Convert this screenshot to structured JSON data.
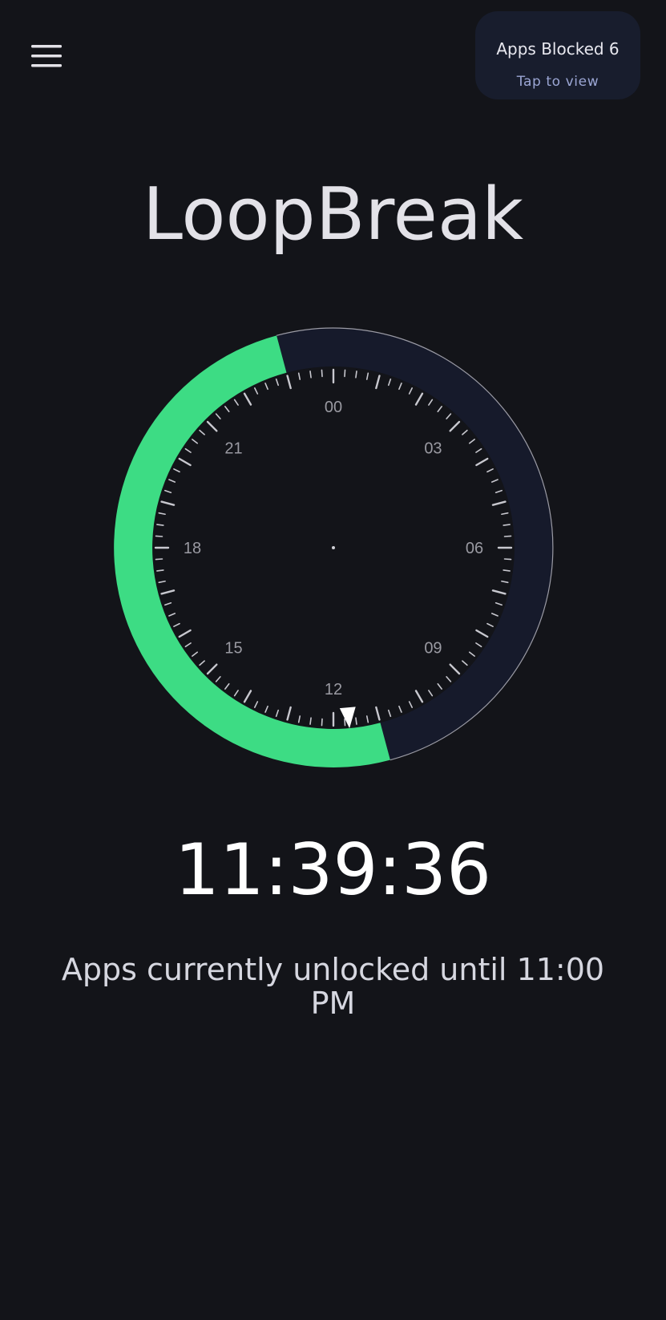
{
  "header": {
    "menu_icon": "hamburger-menu-icon"
  },
  "blocked_card": {
    "title": "Apps Blocked 6",
    "subtitle": "Tap to view"
  },
  "app_title": "LoopBreak",
  "dial": {
    "hour_labels": [
      "00",
      "03",
      "06",
      "09",
      "12",
      "15",
      "18",
      "21"
    ],
    "unlocked_start_hour": 11.0,
    "unlocked_end_hour": 23.0,
    "current_hour": 11.66,
    "colors": {
      "unlocked": "#3ddc84",
      "locked": "#161a2b",
      "face": "#131419",
      "outline": "#9b9ba5",
      "tick": "#c8c8cf",
      "marker": "#ffffff"
    },
    "marker_icon": "current-time-marker-icon"
  },
  "time_readout": "11:39:36",
  "status": "Apps currently unlocked until 11:00 PM"
}
